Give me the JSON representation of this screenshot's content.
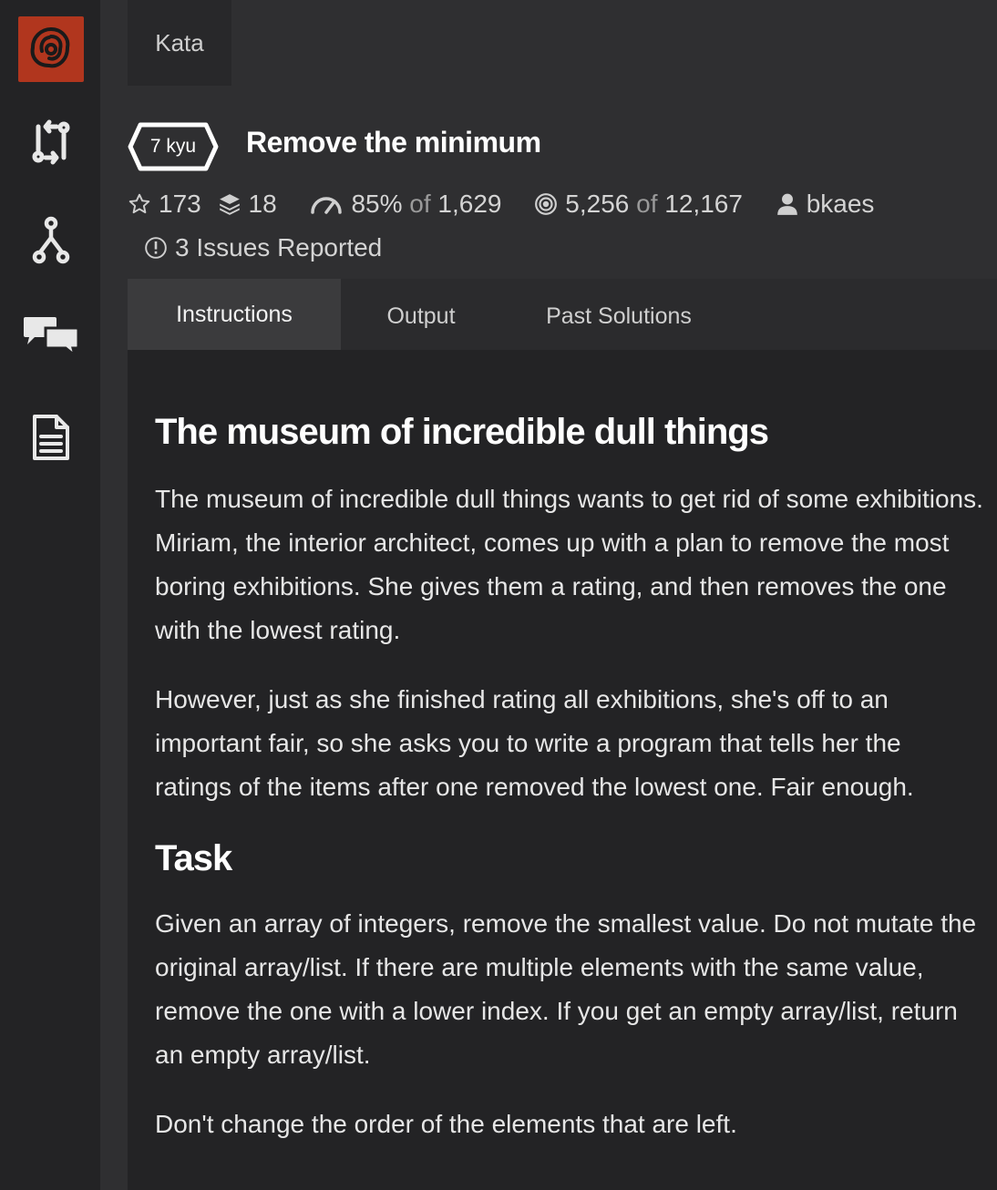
{
  "sidebar": {
    "logo": "codewars-logo",
    "items": [
      {
        "icon": "practice-arrows-icon"
      },
      {
        "icon": "fork-icon"
      },
      {
        "icon": "discuss-chat-icon"
      },
      {
        "icon": "docs-document-icon"
      }
    ]
  },
  "header": {
    "section_tab": "Kata",
    "kyu": "7 kyu",
    "title": "Remove the minimum",
    "stats": {
      "stars": "173",
      "collections": "18",
      "satisfaction_pct": "85%",
      "of_label": "of",
      "satisfaction_votes": "1,629",
      "completed": "5,256",
      "attempted": "12,167",
      "author": "bkaes",
      "issues_count": "3",
      "issues_label": "Issues Reported"
    }
  },
  "tabs": [
    {
      "label": "Instructions",
      "active": true
    },
    {
      "label": "Output",
      "active": false
    },
    {
      "label": "Past Solutions",
      "active": false
    }
  ],
  "content": {
    "heading1": "The museum of incredible dull things",
    "para1": "The museum of incredible dull things wants to get rid of some exhibitions. Miriam, the interior architect, comes up with a plan to remove the most boring exhibitions. She gives them a rating, and then removes the one with the lowest rating.",
    "para2": "However, just as she finished rating all exhibitions, she's off to an important fair, so she asks you to write a program that tells her the ratings of the items after one removed the lowest one. Fair enough.",
    "heading2": "Task",
    "para3": "Given an array of integers, remove the smallest value. Do not mutate the original array/list. If there are multiple elements with the same value, remove the one with a lower index. If you get an empty array/list, return an empty array/list.",
    "para4": "Don't change the order of the elements that are left."
  },
  "colors": {
    "sidebar_bg": "#232325",
    "page_bg": "#2f2f31",
    "logo_red": "#b1361e",
    "active_tab": "#3b3b3d"
  }
}
